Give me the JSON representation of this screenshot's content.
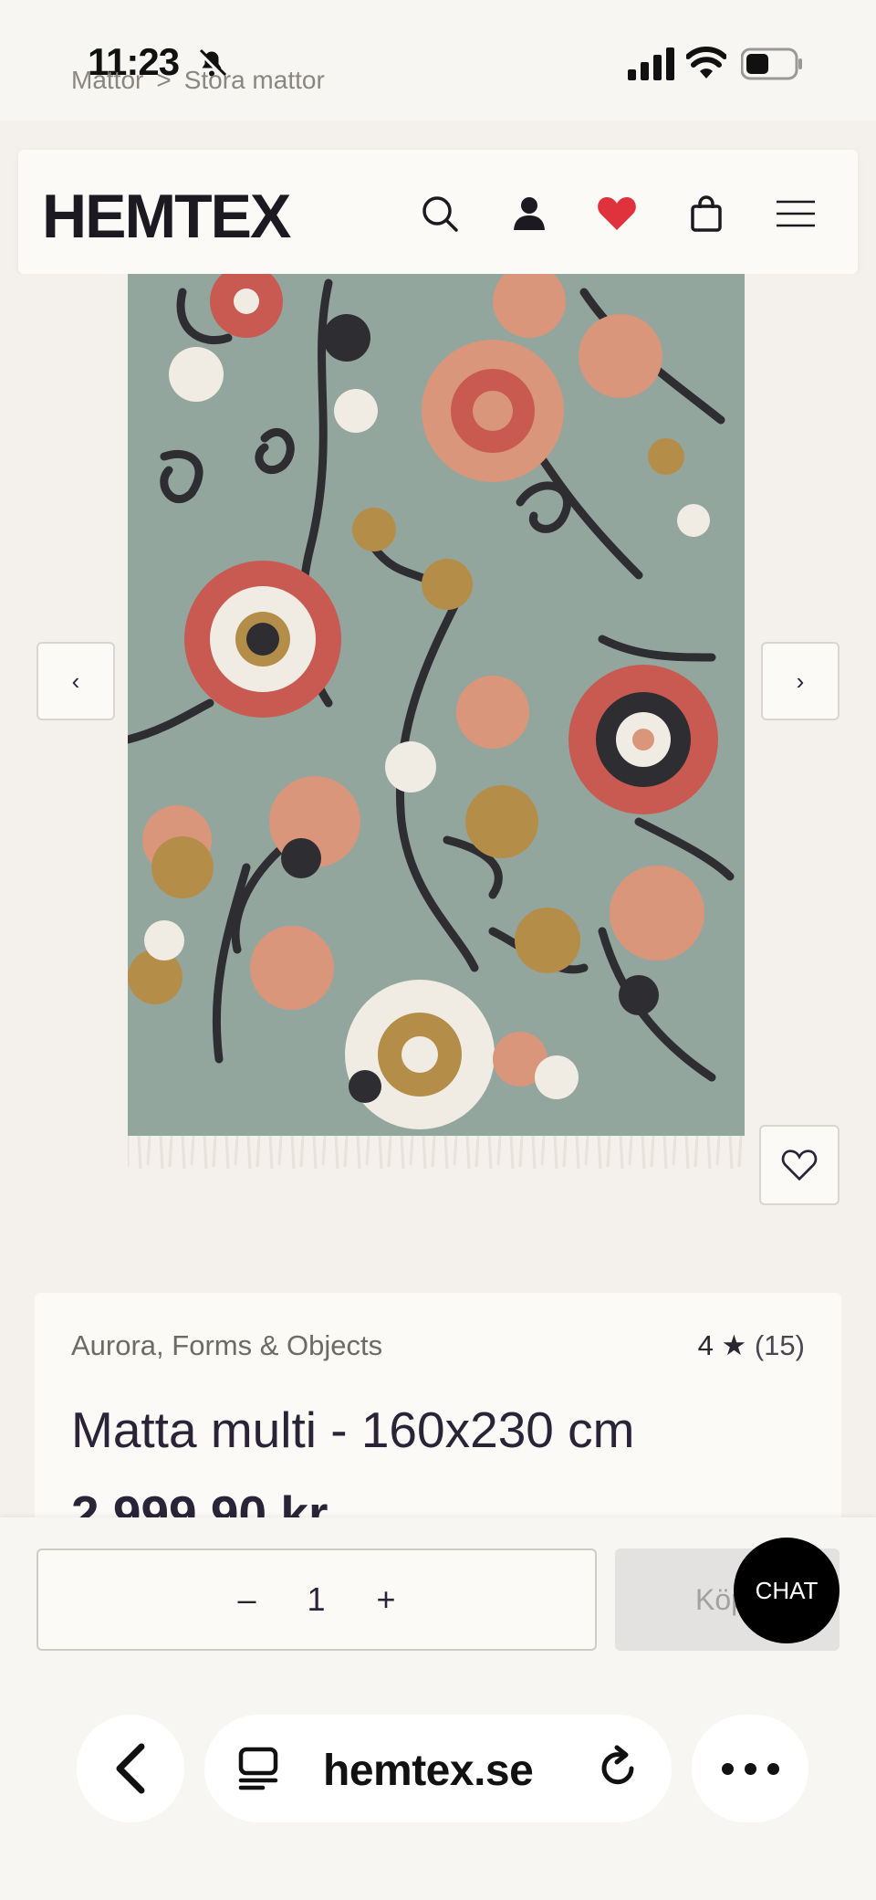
{
  "status_bar": {
    "time": "11:23"
  },
  "breadcrumb": {
    "items": [
      "Mattor",
      "Stora mattor"
    ],
    "separator": ">"
  },
  "header": {
    "logo": "HEMTEX",
    "icons": [
      "search-icon",
      "account-icon",
      "heart-icon",
      "bag-icon",
      "menu-icon"
    ],
    "wishlist_color": "#e0323c"
  },
  "gallery": {
    "prev_label": "‹",
    "next_label": "›",
    "rug_colors": {
      "base": "#8ea39a",
      "red": "#c85a52",
      "peach": "#d9967a",
      "cream": "#f0ece4",
      "mustard": "#b48e48",
      "dark": "#2e2d31"
    }
  },
  "product": {
    "brand": "Aurora, Forms & Objects",
    "rating": "4",
    "rating_star": "★",
    "rating_count": "(15)",
    "title": "Matta multi - 160x230 cm",
    "price": "2 999,90 kr"
  },
  "purchase": {
    "qty_minus": "–",
    "qty_value": "1",
    "qty_plus": "+",
    "buy_label": "Köp",
    "chat_label": "CHAT"
  },
  "browser": {
    "url": "hemtex.se"
  }
}
